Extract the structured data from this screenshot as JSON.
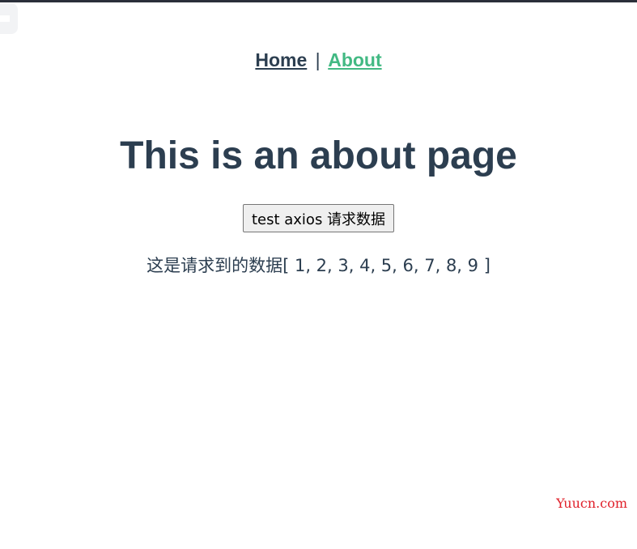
{
  "nav": {
    "home_label": "Home",
    "separator": "|",
    "about_label": "About"
  },
  "main": {
    "title": "This is an about page",
    "button_label": "test axios 请求数据",
    "result_prefix": "这是请求到的数据",
    "result_values": "[ 1, 2, 3, 4, 5, 6, 7, 8, 9 ]"
  },
  "watermark": {
    "text": "Yuucn.com"
  },
  "colors": {
    "text": "#2c3e50",
    "active_link": "#42b983",
    "watermark": "#e0202a"
  }
}
